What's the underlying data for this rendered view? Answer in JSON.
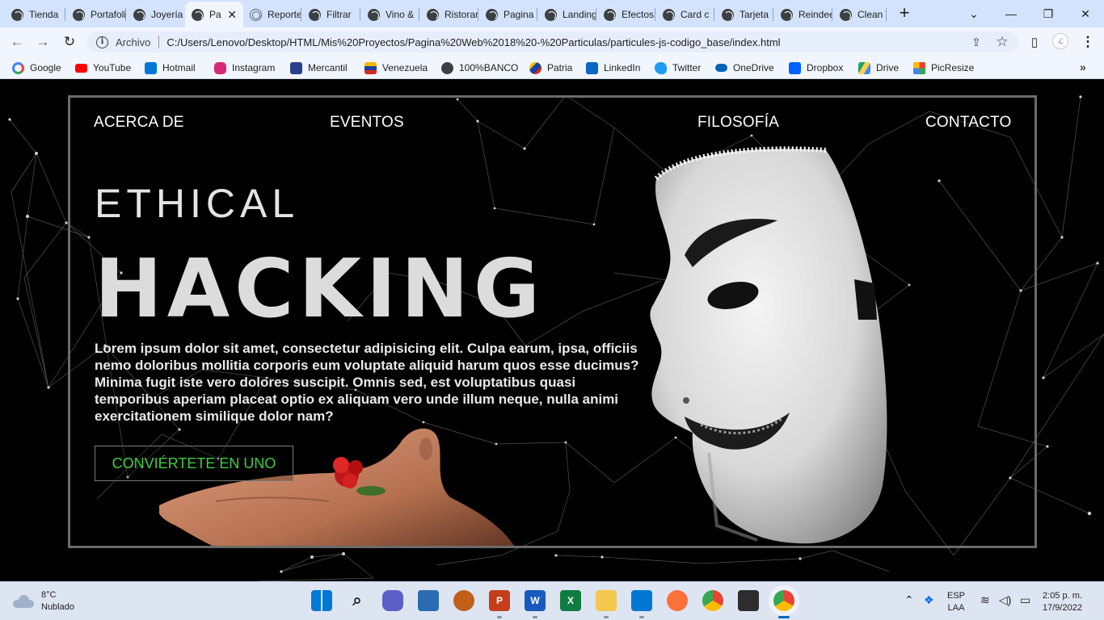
{
  "browser": {
    "tabs": [
      {
        "title": "Tienda"
      },
      {
        "title": "Portafolio"
      },
      {
        "title": "Joyería"
      },
      {
        "title": "Pa",
        "active": true
      },
      {
        "title": "Reportes"
      },
      {
        "title": "Filtrar"
      },
      {
        "title": "Vino &"
      },
      {
        "title": "Ristorante"
      },
      {
        "title": "Pagina"
      },
      {
        "title": "Landing"
      },
      {
        "title": "Efectos"
      },
      {
        "title": "Card c"
      },
      {
        "title": "Tarjeta"
      },
      {
        "title": "Reindeer"
      },
      {
        "title": "Clean"
      }
    ],
    "close_tab_glyph": "✕",
    "new_tab_glyph": "+",
    "window_controls": {
      "tab_search": "⌄",
      "minimize": "—",
      "maximize": "❐",
      "close": "✕"
    },
    "address": {
      "label": "Archivo",
      "url": "C:/Users/Lenovo/Desktop/HTML/Mis%20Proyectos/Pagina%20Web%2018%20-%20Particulas/particules-js-codigo_base/index.html"
    },
    "toolbar_glyphs": {
      "back": "←",
      "forward": "→",
      "reload": "↻",
      "share": "⇪",
      "bookmark_star": "☆",
      "sidebar": "▯",
      "menu": "⋮",
      "profile": "ℒ"
    },
    "bookmarks": [
      {
        "label": "Google",
        "icon": "google-icon",
        "color": "#4285f4"
      },
      {
        "label": "YouTube",
        "icon": "youtube-icon",
        "color": "#ff0000"
      },
      {
        "label": "Hotmail",
        "icon": "outlook-icon",
        "color": "#0078d4"
      },
      {
        "label": "Instagram",
        "icon": "instagram-icon",
        "color": "#d62976"
      },
      {
        "label": "Mercantil",
        "icon": "mercantil-icon",
        "color": "#2a3f8f"
      },
      {
        "label": "Venezuela",
        "icon": "venezuela-icon",
        "color": "#f2b800"
      },
      {
        "label": "100%BANCO",
        "icon": "globe-icon",
        "color": "#3c4043"
      },
      {
        "label": "Patria",
        "icon": "patria-icon",
        "color": "#d52b1e"
      },
      {
        "label": "LinkedIn",
        "icon": "linkedin-icon",
        "color": "#0a66c2"
      },
      {
        "label": "Twitter",
        "icon": "twitter-icon",
        "color": "#1d9bf0"
      },
      {
        "label": "OneDrive",
        "icon": "onedrive-icon",
        "color": "#0364b8"
      },
      {
        "label": "Dropbox",
        "icon": "dropbox-icon",
        "color": "#0061fe"
      },
      {
        "label": "Drive",
        "icon": "drive-icon",
        "color": "#1fa463"
      },
      {
        "label": "PicResize",
        "icon": "picresize-icon",
        "color": "#e94235"
      }
    ],
    "bookmarks_more": "»"
  },
  "page": {
    "nav": {
      "about": "ACERCA DE",
      "events": "EVENTOS",
      "philosophy": "FILOSOFÍA",
      "contact": "CONTACTO"
    },
    "hero": {
      "title_top": "ETHICAL",
      "title_main": "HACKING",
      "paragraph": "Lorem ipsum dolor sit amet, consectetur adipisicing elit. Culpa earum, ipsa, officiis nemo doloribus mollitia corporis eum voluptate aliquid harum quos esse ducimus? Minima fugit iste vero dolores suscipit. Omnis sed, est voluptatibus quasi temporibus aperiam placeat optio ex aliquam vero unde illum neque, nulla animi exercitationem similique dolor nam?",
      "cta": "CONVIÉRTETE EN UNO"
    },
    "colors": {
      "cta_text": "#3ecf3e",
      "frame_border": "#6b6b6b",
      "background": "#000000"
    }
  },
  "taskbar": {
    "weather": {
      "temp": "8°C",
      "condition": "Nublado"
    },
    "apps": [
      "windows-start-icon",
      "search-icon",
      "teams-chat-icon",
      "photos-icon",
      "app-icon",
      "powerpoint-icon",
      "word-icon",
      "excel-icon",
      "file-explorer-icon",
      "vscode-icon",
      "firefox-icon",
      "chrome-icon",
      "terminal-icon",
      "chrome-profile-icon"
    ],
    "tray": {
      "language_line1": "ESP",
      "language_line2": "LAA",
      "time": "2:05 p. m.",
      "date": "17/9/2022",
      "glyphs": {
        "chevron": "⌃",
        "wifi": "≋",
        "volume": "◁)",
        "battery": "▭"
      }
    }
  }
}
